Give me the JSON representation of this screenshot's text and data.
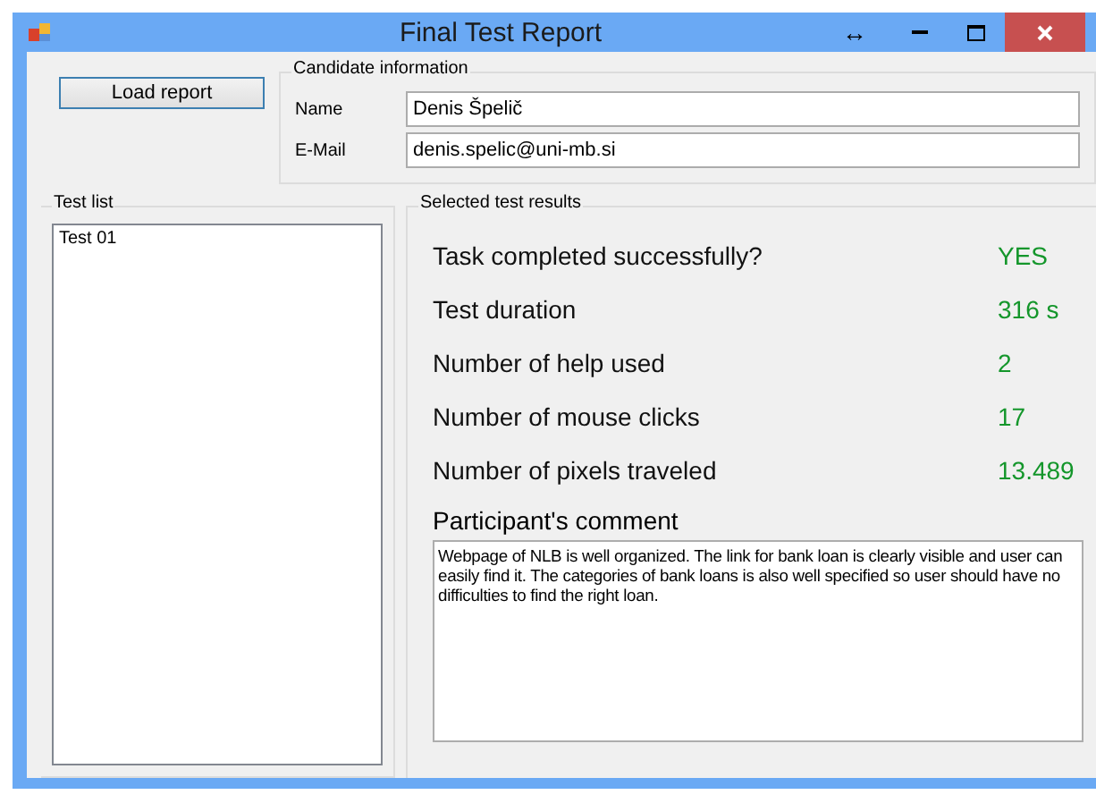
{
  "window": {
    "title": "Final Test Report",
    "controls": [
      "↔"
    ]
  },
  "load_button": {
    "label": "Load report"
  },
  "candidate": {
    "title": "Candidate information",
    "fields": [
      {
        "label": "Name",
        "value": "Denis Špelič"
      },
      {
        "label": "E-Mail",
        "value": "denis.spelic@uni-mb.si"
      }
    ]
  },
  "test_list": {
    "title": "Test list",
    "items": [
      {
        "label": "Test 01",
        "selected": false
      }
    ]
  },
  "results": {
    "title": "Selected test results",
    "rows": [
      {
        "label": "Task completed successfully?",
        "value": "YES"
      },
      {
        "label": "Test duration",
        "value": "316 s"
      },
      {
        "label": "Number of help used",
        "value": "2"
      },
      {
        "label": "Number of mouse clicks",
        "value": "17"
      },
      {
        "label": "Number of pixels traveled",
        "value": "13.489"
      }
    ],
    "comment_label": "Participant's comment",
    "comment": "Webpage of NLB is well organized. The link for bank loan is clearly visible and user can easily find it. The categories of bank loans is also well specified so user should have no difficulties to find the right loan."
  }
}
